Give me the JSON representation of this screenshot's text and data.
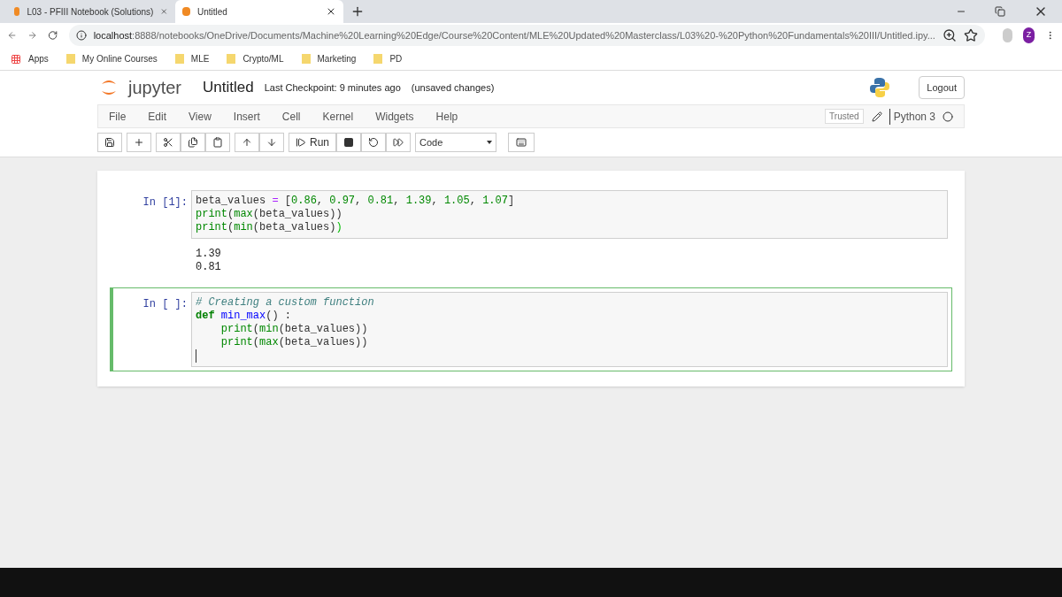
{
  "browser": {
    "tabs": [
      {
        "label": "L03 - PFIII Notebook (Solutions)",
        "selected": false
      },
      {
        "label": "Untitled",
        "selected": true
      }
    ],
    "url_host": "localhost",
    "url_rest": ":8888/notebooks/OneDrive/Documents/Machine%20Learning%20Edge/Course%20Content/MLE%20Updated%20Masterclass/L03%20-%20Python%20Fundamentals%20III/Untitled.ipy...",
    "profile_initial": "Z",
    "bookmarks": [
      {
        "label": "Apps",
        "kind": "apps"
      },
      {
        "label": "My Online Courses",
        "kind": "folder"
      },
      {
        "label": "MLE",
        "kind": "folder"
      },
      {
        "label": "Crypto/ML",
        "kind": "folder"
      },
      {
        "label": "Marketing",
        "kind": "folder"
      },
      {
        "label": "PD",
        "kind": "folder"
      }
    ]
  },
  "header": {
    "logo_text": "jupyter",
    "notebook_name": "Untitled",
    "checkpoint": "Last Checkpoint: 9 minutes ago",
    "unsaved": "(unsaved changes)",
    "logout": "Logout"
  },
  "menu": [
    "File",
    "Edit",
    "View",
    "Insert",
    "Cell",
    "Kernel",
    "Widgets",
    "Help"
  ],
  "trusted": "Trusted",
  "kernel": "Python 3",
  "toolbar": {
    "run": "Run",
    "cell_type": "Code"
  },
  "cells": [
    {
      "prompt": "In [1]:",
      "selected": false,
      "lines": [
        [
          {
            "text": "beta_values",
            "kind": "plain"
          },
          {
            "text": " = ",
            "kind": "op"
          },
          {
            "text": "[",
            "kind": "plain"
          },
          {
            "text": "0.86",
            "kind": "num"
          },
          {
            "text": ", ",
            "kind": "plain"
          },
          {
            "text": "0.97",
            "kind": "num"
          },
          {
            "text": ", ",
            "kind": "plain"
          },
          {
            "text": "0.81",
            "kind": "num"
          },
          {
            "text": ", ",
            "kind": "plain"
          },
          {
            "text": "1.39",
            "kind": "num"
          },
          {
            "text": ", ",
            "kind": "plain"
          },
          {
            "text": "1.05",
            "kind": "num"
          },
          {
            "text": ", ",
            "kind": "plain"
          },
          {
            "text": "1.07",
            "kind": "num"
          },
          {
            "text": "]",
            "kind": "plain"
          }
        ],
        [
          {
            "text": "print",
            "kind": "builtin"
          },
          {
            "text": "(",
            "kind": "plain"
          },
          {
            "text": "max",
            "kind": "builtin"
          },
          {
            "text": "(beta_values))",
            "kind": "plain"
          }
        ],
        [
          {
            "text": "print",
            "kind": "builtin"
          },
          {
            "text": "(",
            "kind": "plain"
          },
          {
            "text": "min",
            "kind": "builtin"
          },
          {
            "text": "(beta_values)",
            "kind": "plain"
          },
          {
            "text": ")",
            "kind": "match"
          }
        ]
      ],
      "output": [
        "1.39",
        "0.81"
      ]
    },
    {
      "prompt": "In [ ]:",
      "selected": true,
      "lines": [
        [
          {
            "text": "# Creating a custom function",
            "kind": "comment"
          }
        ],
        [
          {
            "text": "def ",
            "kind": "keyword"
          },
          {
            "text": "min_max",
            "kind": "def"
          },
          {
            "text": "() :",
            "kind": "plain"
          }
        ],
        [
          {
            "text": "    print",
            "kind": "builtin"
          },
          {
            "text": "(",
            "kind": "plain"
          },
          {
            "text": "min",
            "kind": "builtin"
          },
          {
            "text": "(beta_values))",
            "kind": "plain"
          }
        ],
        [
          {
            "text": "    print",
            "kind": "builtin"
          },
          {
            "text": "(",
            "kind": "plain"
          },
          {
            "text": "max",
            "kind": "builtin"
          },
          {
            "text": "(beta_values))",
            "kind": "plain"
          }
        ]
      ]
    }
  ]
}
